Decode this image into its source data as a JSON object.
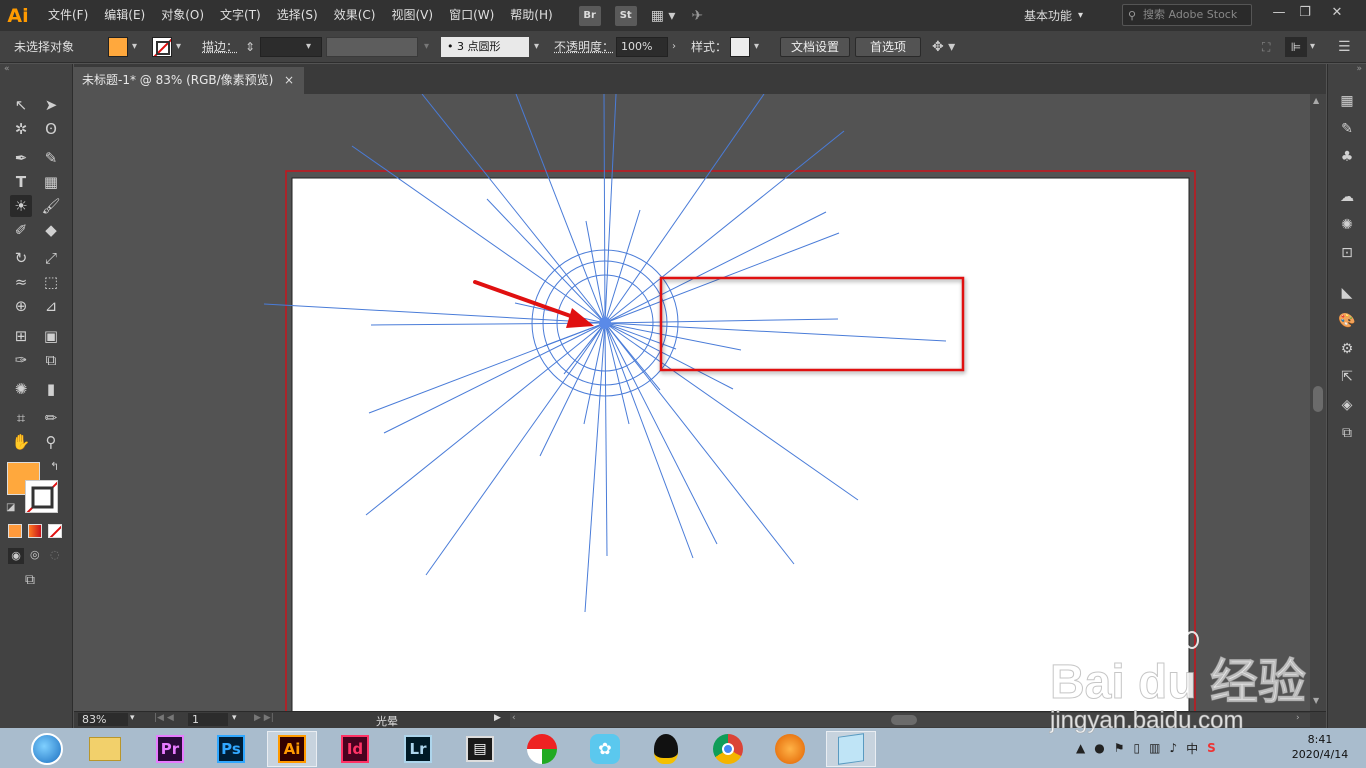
{
  "app": {
    "logo": "Ai"
  },
  "menu": [
    "文件(F)",
    "编辑(E)",
    "对象(O)",
    "文字(T)",
    "选择(S)",
    "效果(C)",
    "视图(V)",
    "窗口(W)",
    "帮助(H)"
  ],
  "menubar_buttons": [
    "Br",
    "St"
  ],
  "workspace": {
    "label": "基本功能"
  },
  "search": {
    "placeholder": "搜索 Adobe Stock"
  },
  "control": {
    "selection_label": "未选择对象",
    "fill_color": "#ffa83d",
    "stroke_label": "描边：",
    "brush_label": "3 点圆形",
    "opacity_label": "不透明度：",
    "opacity_value": "100%",
    "style_label": "样式：",
    "doc_setup_btn": "文档设置",
    "prefs_btn": "首选项"
  },
  "tab": {
    "title": "未标题-1* @ 83% (RGB/像素预览)",
    "close": "×"
  },
  "status": {
    "zoom": "83%",
    "artboard": "1",
    "tool": "光晕"
  },
  "taskbar": {
    "apps": [
      {
        "name": "Pr",
        "color": "#e77cff",
        "bg": "#2a0a3a"
      },
      {
        "name": "Ps",
        "color": "#31a8ff",
        "bg": "#001e36"
      },
      {
        "name": "Ai",
        "color": "#ff9a00",
        "bg": "#330000"
      },
      {
        "name": "Id",
        "color": "#ff3366",
        "bg": "#49021f"
      },
      {
        "name": "Lr",
        "color": "#add5ec",
        "bg": "#001a26"
      }
    ],
    "ime": "中",
    "time": "8:41",
    "date": "2020/4/14"
  },
  "watermark": {
    "text": "Bai du 经验",
    "url": "jingyan.baidu.com"
  }
}
